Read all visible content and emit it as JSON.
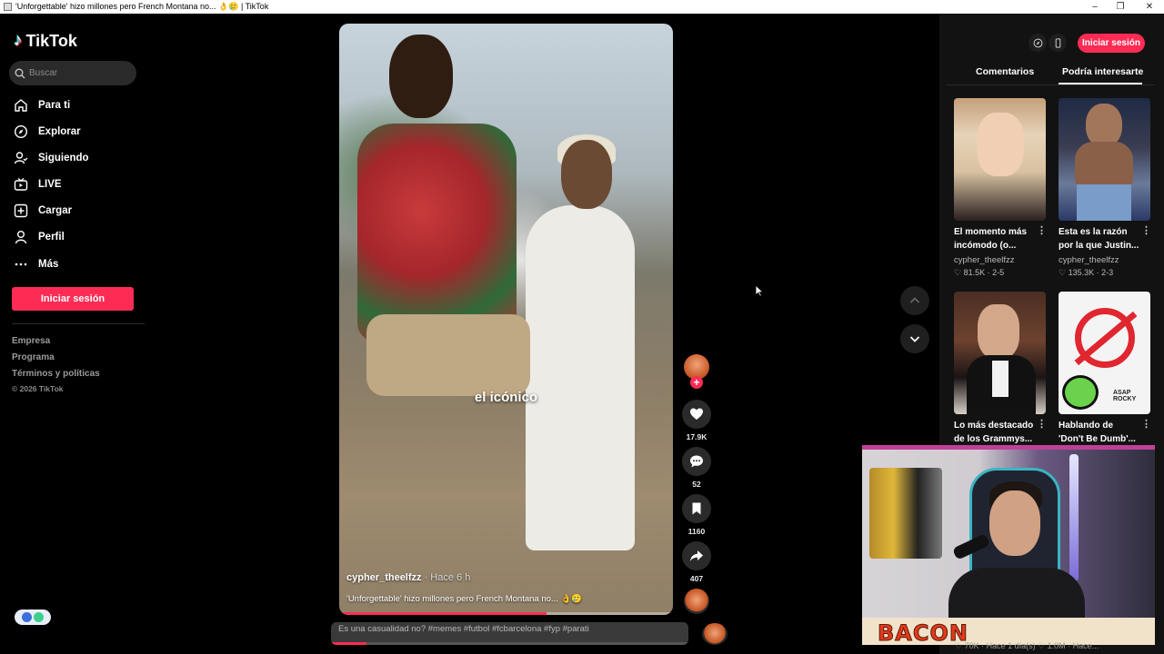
{
  "window": {
    "title": "'Unforgettable' hizo millones pero French Montana no... 👌🥲 | TikTok"
  },
  "sidebar": {
    "logo": "TikTok",
    "search_placeholder": "Buscar",
    "items": [
      {
        "label": "Para ti",
        "icon": "home-icon"
      },
      {
        "label": "Explorar",
        "icon": "compass-icon"
      },
      {
        "label": "Siguiendo",
        "icon": "following-icon"
      },
      {
        "label": "LIVE",
        "icon": "live-icon"
      },
      {
        "label": "Cargar",
        "icon": "upload-icon"
      },
      {
        "label": "Perfil",
        "icon": "profile-icon"
      },
      {
        "label": "Más",
        "icon": "more-icon"
      }
    ],
    "login_label": "Iniciar sesión",
    "footer_links": [
      "Empresa",
      "Programa",
      "Términos y políticas"
    ],
    "copyright": "© 2026 TikTok"
  },
  "video": {
    "caption_overlay": "el icónico",
    "author": "cypher_theelfzz",
    "time": " · Hace 6 h",
    "description": "'Unforgettable' hizo millones pero French Montana no... 👌🥲",
    "progress": 0.62
  },
  "actions": {
    "likes": "17.9K",
    "comments": "52",
    "saves": "1160",
    "shares": "407"
  },
  "next_video": {
    "description": "Es una casualidad no? #memes #futbol #fcbarcelona #fyp #parati",
    "progress": 0.1
  },
  "right_panel": {
    "tabs": [
      "Comentarios",
      "Podría interesarte"
    ],
    "active_tab": "Podría interesarte",
    "login_label": "Iniciar sesión",
    "cards": [
      {
        "title": "El momento más incómodo (o...",
        "author": "cypher_theelfzz",
        "likes": "81.5K",
        "parts": "2-5"
      },
      {
        "title": "Esta es la razón por la que Justin...",
        "author": "cypher_theelfzz",
        "likes": "135.3K",
        "parts": "2-3"
      },
      {
        "title": "Lo más destacado de los Grammys...",
        "author": "",
        "likes": "",
        "parts": ""
      },
      {
        "title": "Hablando de 'Don't Be Dumb'...",
        "author": "",
        "likes": "",
        "parts": ""
      }
    ],
    "peek_stats": "♡ 70K · Hace 1 día(s)        ♡ 1.0M · Hace..."
  },
  "webcam": {
    "brand": "BACON"
  },
  "colors": {
    "accent": "#fe2c55",
    "background": "#000000",
    "panel": "#121212"
  }
}
